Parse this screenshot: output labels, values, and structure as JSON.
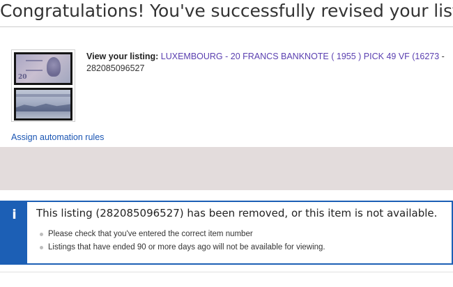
{
  "heading": {
    "title": "Congratulations! You've successfully revised your listing."
  },
  "listing": {
    "view_label": "View your listing:",
    "title_link": "LUXEMBOURG - 20 FRANCS BANKNOTE ( 1955 ) PICK 49 VF (16273",
    "separator": " - ",
    "item_number": "282085096527",
    "thumbnail": {
      "front_text": "20",
      "icon": "banknote-thumbnail"
    }
  },
  "links": {
    "automation": "Assign automation rules"
  },
  "alert": {
    "icon_glyph": "i",
    "title": "This listing (282085096527) has been removed, or this item is not available.",
    "items": [
      "Please check that you've entered the correct item number",
      "Listings that have ended 90 or more days ago will not be available for viewing."
    ]
  },
  "colors": {
    "link_purple": "#5a3fb0",
    "link_blue": "#1a55b3",
    "alert_blue": "#1c5fb5",
    "grey_band": "#e3dcdc"
  }
}
